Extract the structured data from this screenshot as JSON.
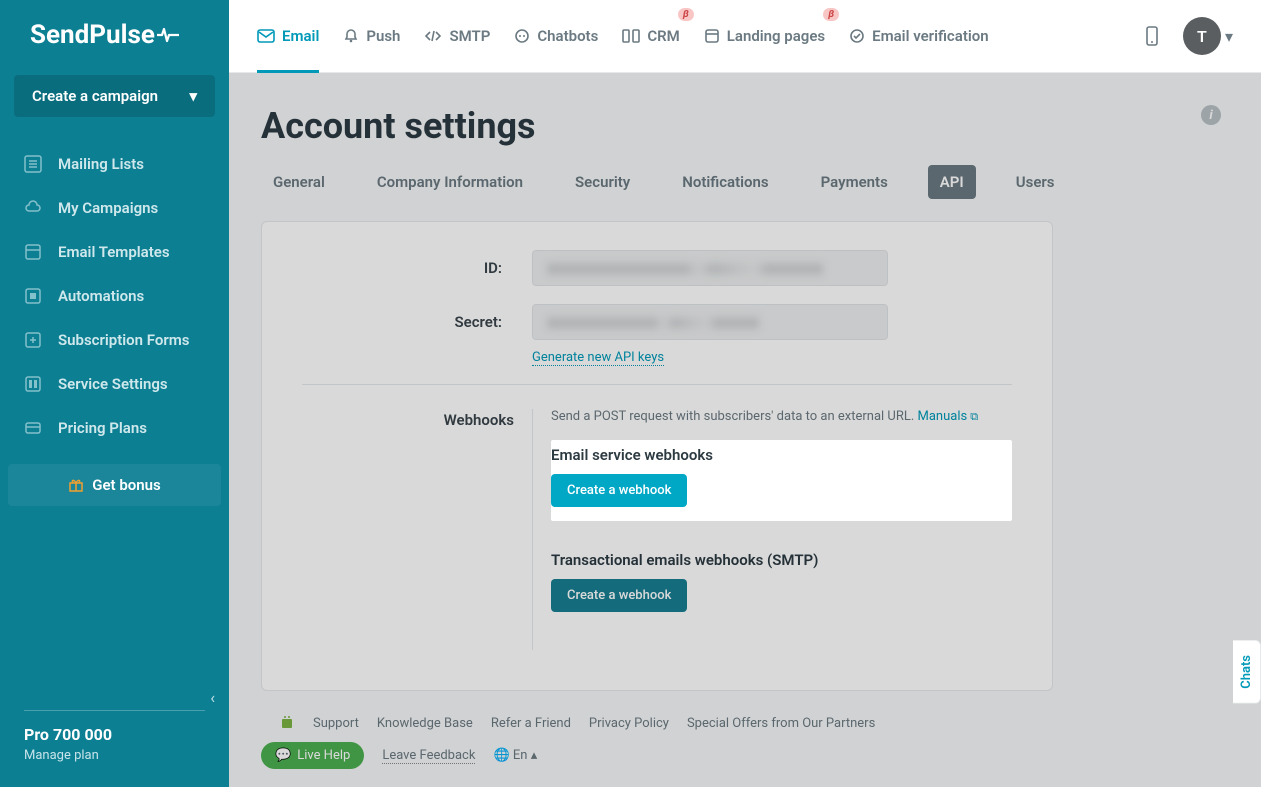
{
  "brand": {
    "name": "SendPulse"
  },
  "sidebar": {
    "create_label": "Create a campaign",
    "items": [
      {
        "label": "Mailing Lists"
      },
      {
        "label": "My Campaigns"
      },
      {
        "label": "Email Templates"
      },
      {
        "label": "Automations"
      },
      {
        "label": "Subscription Forms"
      },
      {
        "label": "Service Settings"
      },
      {
        "label": "Pricing Plans"
      }
    ],
    "bonus_label": "Get bonus",
    "plan": {
      "name": "Pro 700 000",
      "manage": "Manage plan"
    }
  },
  "topnav": {
    "items": [
      {
        "label": "Email",
        "active": true
      },
      {
        "label": "Push"
      },
      {
        "label": "SMTP"
      },
      {
        "label": "Chatbots"
      },
      {
        "label": "CRM",
        "beta": true
      },
      {
        "label": "Landing pages",
        "beta": true
      },
      {
        "label": "Email verification"
      }
    ],
    "beta_symbol": "β",
    "avatar_initial": "T"
  },
  "page": {
    "title": "Account settings",
    "tabs": [
      {
        "label": "General"
      },
      {
        "label": "Company Information"
      },
      {
        "label": "Security"
      },
      {
        "label": "Notifications"
      },
      {
        "label": "Payments"
      },
      {
        "label": "API",
        "active": true
      },
      {
        "label": "Users"
      }
    ]
  },
  "api": {
    "id_label": "ID:",
    "secret_label": "Secret:",
    "generate_link": "Generate new API keys",
    "webhooks_label": "Webhooks",
    "webhooks_desc": "Send a POST request with subscribers' data to an external URL.",
    "manuals_link": "Manuals",
    "email_webhooks_heading": "Email service webhooks",
    "smtp_webhooks_heading": "Transactional emails webhooks (SMTP)",
    "create_webhook_btn": "Create a webhook"
  },
  "footer": {
    "links": [
      "Support",
      "Knowledge Base",
      "Refer a Friend",
      "Privacy Policy",
      "Special Offers from Our Partners"
    ],
    "live_help": "Live Help",
    "leave_feedback": "Leave Feedback",
    "lang": "En"
  },
  "chats_tab": "Chats"
}
